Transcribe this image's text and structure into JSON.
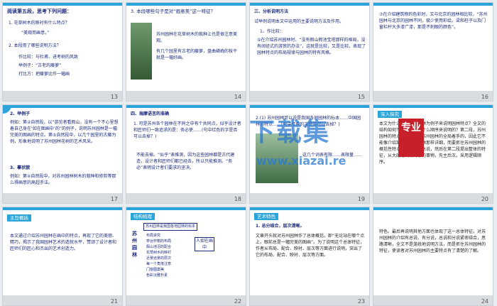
{
  "watermark": {
    "main": "下载集",
    "sub": "www.xiazai.re",
    "seal": "专业"
  },
  "slides": [
    {
      "num": "13",
      "title": "阅读第五段，思考下列问题：",
      "q1": "1. 花草树木的映衬有什么特点？",
      "a1": "“美观而画意。”",
      "q2": "2. 本段用了哪些说明方法？",
      "a2a": "作比较：与杜甫、进考树的风致",
      "a2b": "举例子：“古老的藤萝”",
      "a2c": "打比方：把藤萝比作一幅画"
    },
    {
      "num": "14",
      "title": "3. 本段哪些句子是对“画意美”这一特征？",
      "b1": "苏州园林在花草树木的栽种上也是很注意美观。",
      "b2": "有几个园里有古老的藤萝，盘曲嶙峋的枝干就是一幅好画。"
    },
    {
      "num": "15",
      "heading": "三、分析说明方法",
      "intro": "试举例说明本文中运用的主要说明方法及作用。",
      "m1": "1、作比较：",
      "body": "⑤在介绍苏州园林时，“没有假山假池宝塔那样的格局，没有阔径式的游赏的办法”，这就是比较，又是比较，表现了园林特点的布局规律与园林的特有风格。"
    },
    {
      "num": "16",
      "body": "⑦在介绍建筑物的色彩时，又与北京的园林相比较，“苏州园林与北京的园林不同，极少使用彩绘。梁和柱子以及门窗栏杆大多漆广漆，那是不刺眼的颜色”。"
    },
    {
      "num": "17",
      "m2": "2、举例子",
      "body2": "例如：第②自然段，以“游览者看假山，没有一个不心里想着自己身在‘如在图画中’的”的例子，说明苏州园林是一幅完美的图画的特点。第⑤自然段中，以几个园里的古藤为例，形象地说明了苏州园林花树的艺术风采。",
      "m3": "3、摹状貌",
      "body3": "例如：第④自然段中，对苏州园林树木的栽种和修剪等那么得画意的高超手法。"
    },
    {
      "num": "18",
      "heading": "四、揣摩语言的准确",
      "q": "1. 可是苏州各个园林在不同之中有个共同点，似乎设计者和匠师们一致追求的是：务必使……(句中红色的字是否可以去掉？)",
      "ans": "不能去掉。“似乎”表推测，因为这些园林都是古代建造，设计者和匠师们都已经去，所以只能推测。“务必”表明设计者们要求的坚决。"
    },
    {
      "num": "19",
      "q": "2.(1) 苏州园林可以说是我国各地园林的标本……中国园林的特点……(句中红色的字是否可以去掉？)",
      "a": "这几个词表有限……表限量……"
    },
    {
      "num": "20",
      "badge": "深入探究",
      "body": "本文为什么选择苏州园林为例子来说明园林特点？全文的结构如何？本文是按照什么顺序来说明的？第二段，苏州园林的特点，主要是从苏州园林的全局着手的，因此它不能像介绍某个单一的园林那样详细，而要抓住苏州园林的概括性特点。本文先写总说，然后在第二段提出整体的特征，从大的建筑物到小的事物，先主后次。采用逻辑顺序。"
    },
    {
      "num": "21",
      "badge": "主旨概括",
      "body": "本文通过介绍苏州园林在画中的特点，再现了它的美丽、精巧，揭示了我国园林艺术的造就水平，赞颂了设计者和匠师们的匠心和杰出的艺术创造力。"
    },
    {
      "num": "22",
      "badge": "结构梳理",
      "left": "苏州园林",
      "top": "苏州园林是我国各地园林的标本",
      "s1": "只在图画中",
      "rows": [
        "布局讲究",
        "亭台轩榭的布局",
        "假山池沼的配合",
        "花草树木的映衬",
        "近景远景的层次",
        "每一个角落注意",
        "门窗图案美",
        "色彩淡雅朴素"
      ],
      "center": "人如在画中"
    },
    {
      "num": "23",
      "badge": "艺术特色",
      "s1": "1. 总分结合，层次清晰。",
      "body": "文章开头就对苏州园林作了总体概括，即“无论站在哪个点上，眼前总是一幅完美的图画”。为了说明这个总体特征，作者从布局、配合、映衬、层次等方面进行说明，突出了它的布局、配合、映衬、层次等方面。"
    },
    {
      "num": "24",
      "body": "特色。最后再说明其他方面也体现了这一总体特征。对苏州园林的介绍有总说、有分说，总说和分说紧密结合，思路清晰，全文不是笼统地说明方法，而是抓住苏州园林的特征，使读者对苏州园林的主要特点有了清楚的了解。"
    }
  ]
}
